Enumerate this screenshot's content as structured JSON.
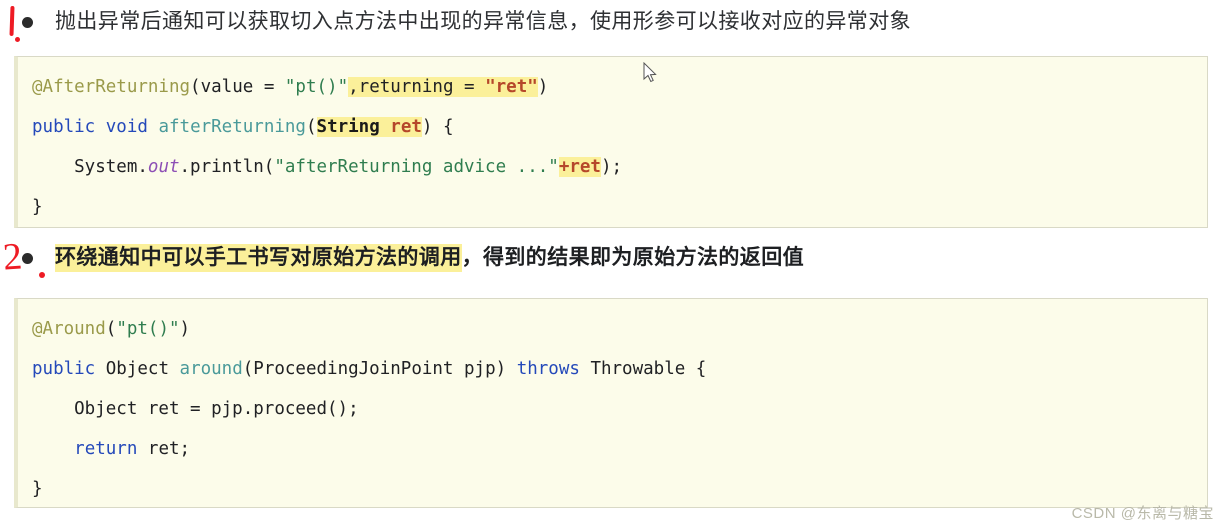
{
  "headings": [
    {
      "id": "h1",
      "marker": "1",
      "plain_before": "抛出异常后通知可以获取切入点方法中出现的异常信息，使用形参可以接收对应的异常对象",
      "highlighted": "",
      "plain_after": ""
    },
    {
      "id": "h2",
      "marker": "2",
      "plain_before": "",
      "highlighted": "环绕通知中可以手工书写对原始方法的调用",
      "plain_after": "，得到的结果即为原始方法的返回值"
    }
  ],
  "code_block_1": {
    "lines": [
      "@AfterReturning(value = \"pt()\",returning = \"ret\")",
      "public void afterReturning(String ret) {",
      "    System.out.println(\"afterReturning advice ...\"+ret);",
      "}"
    ],
    "highlights": [
      ",returning = \"ret\"",
      "String ret",
      "+ret"
    ]
  },
  "code_block_2": {
    "lines": [
      "@Around(\"pt()\")",
      "public Object around(ProceedingJoinPoint pjp) throws Throwable {",
      "    Object ret = pjp.proceed();",
      "    return ret;",
      "}"
    ],
    "highlights": []
  },
  "watermark": "CSDN @东离与糖宝",
  "cursor": "mouse-pointer",
  "colors": {
    "highlight": "#fbf09a",
    "annotation_red": "#ee1b24",
    "code_bg": "#fcfcea",
    "code_border": "#d9d9c6",
    "keyword_blue": "#2449ba",
    "string_green": "#2f7d4f",
    "annotation_olive": "#9a9a4a",
    "method_teal": "#4a9a9a",
    "field_purple": "#8d4fb5",
    "ret_red": "#b5472a",
    "watermark_grey": "#b9b9a9"
  }
}
